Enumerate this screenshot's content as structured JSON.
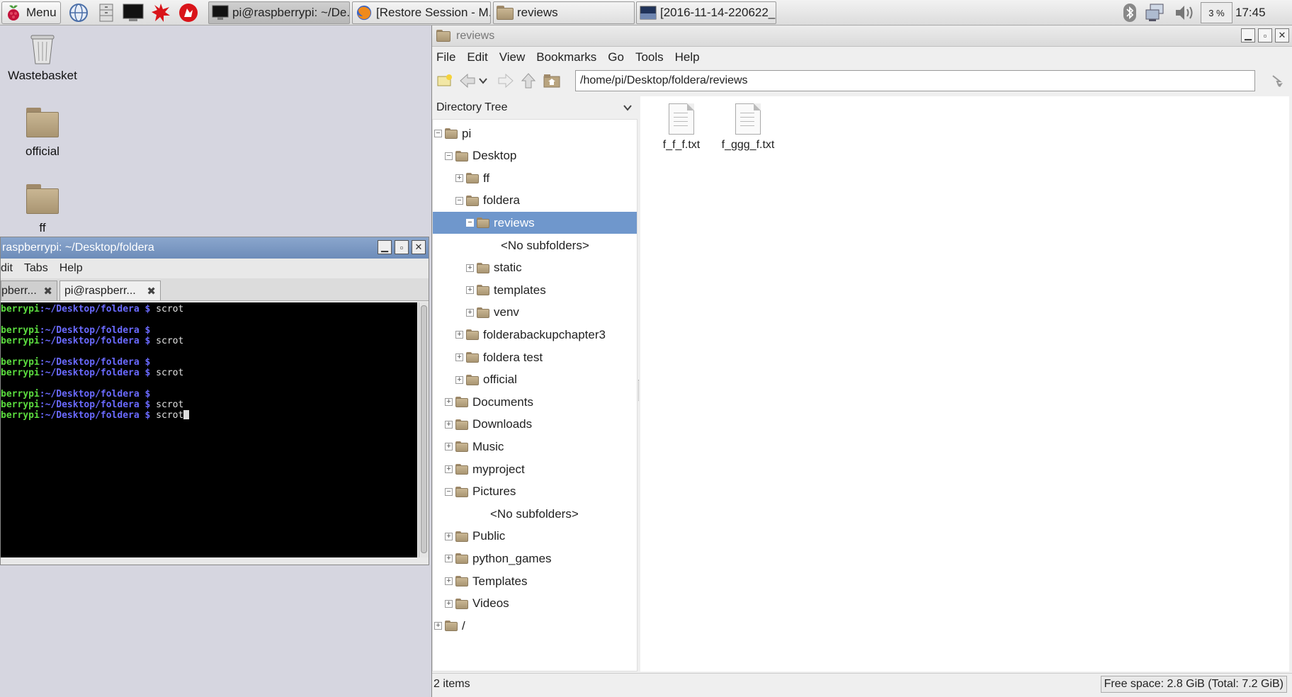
{
  "taskbar": {
    "menu_label": "Menu",
    "tasks": [
      {
        "label": "pi@raspberrypi: ~/De..."
      },
      {
        "label": "[Restore Session - M..."
      },
      {
        "label": "reviews"
      },
      {
        "label": "[2016-11-14-220622_..."
      }
    ],
    "cpu": "3 %",
    "clock": "17:45"
  },
  "desktop": {
    "icons": [
      {
        "label": "Wastebasket"
      },
      {
        "label": "official"
      },
      {
        "label": "ff"
      }
    ]
  },
  "terminal": {
    "title": "raspberrypi: ~/Desktop/foldera",
    "menu": [
      "dit",
      "Tabs",
      "Help"
    ],
    "tabs": [
      {
        "label": "pberr..."
      },
      {
        "label": "pi@raspberr..."
      }
    ],
    "lines": [
      {
        "user": "berrypi",
        "path": ":~/Desktop/foldera $",
        "cmd": " scrot"
      },
      {
        "user": "",
        "path": "",
        "cmd": ""
      },
      {
        "user": "berrypi",
        "path": ":~/Desktop/foldera $",
        "cmd": ""
      },
      {
        "user": "berrypi",
        "path": ":~/Desktop/foldera $",
        "cmd": " scrot"
      },
      {
        "user": "",
        "path": "",
        "cmd": ""
      },
      {
        "user": "berrypi",
        "path": ":~/Desktop/foldera $",
        "cmd": ""
      },
      {
        "user": "berrypi",
        "path": ":~/Desktop/foldera $",
        "cmd": " scrot"
      },
      {
        "user": "",
        "path": "",
        "cmd": ""
      },
      {
        "user": "berrypi",
        "path": ":~/Desktop/foldera $",
        "cmd": ""
      },
      {
        "user": "berrypi",
        "path": ":~/Desktop/foldera $",
        "cmd": " scrot"
      },
      {
        "user": "berrypi",
        "path": ":~/Desktop/foldera $",
        "cmd": " scrot"
      }
    ]
  },
  "filemanager": {
    "title": "reviews",
    "menu": [
      "File",
      "Edit",
      "View",
      "Bookmarks",
      "Go",
      "Tools",
      "Help"
    ],
    "path": "/home/pi/Desktop/foldera/reviews",
    "sidebar_title": "Directory Tree",
    "tree": [
      {
        "label": "pi",
        "exp": "−"
      },
      {
        "label": "Desktop",
        "exp": "−"
      },
      {
        "label": "ff",
        "exp": "+"
      },
      {
        "label": "foldera",
        "exp": "−"
      },
      {
        "label": "reviews",
        "exp": "−"
      },
      {
        "label": "<No subfolders>",
        "exp": ""
      },
      {
        "label": "static",
        "exp": "+"
      },
      {
        "label": "templates",
        "exp": "+"
      },
      {
        "label": "venv",
        "exp": "+"
      },
      {
        "label": "folderabackupchapter3",
        "exp": "+"
      },
      {
        "label": "foldera test",
        "exp": "+"
      },
      {
        "label": "official",
        "exp": "+"
      },
      {
        "label": "Documents",
        "exp": "+"
      },
      {
        "label": "Downloads",
        "exp": "+"
      },
      {
        "label": "Music",
        "exp": "+"
      },
      {
        "label": "myproject",
        "exp": "+"
      },
      {
        "label": "Pictures",
        "exp": "−"
      },
      {
        "label": "<No subfolders>",
        "exp": ""
      },
      {
        "label": "Public",
        "exp": "+"
      },
      {
        "label": "python_games",
        "exp": "+"
      },
      {
        "label": "Templates",
        "exp": "+"
      },
      {
        "label": "Videos",
        "exp": "+"
      },
      {
        "label": "/",
        "exp": "+"
      }
    ],
    "files": [
      {
        "name": "f_f_f.txt"
      },
      {
        "name": "f_ggg_f.txt"
      }
    ],
    "status_items": "2 items",
    "status_free": "Free space: 2.8 GiB (Total: 7.2 GiB)"
  }
}
